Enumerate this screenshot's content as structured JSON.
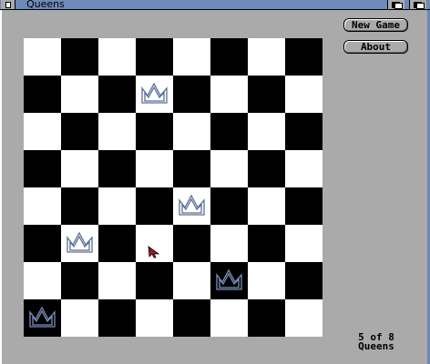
{
  "window": {
    "title": "Queens"
  },
  "buttons": {
    "new_game": "New Game",
    "about": "About"
  },
  "status": {
    "line1": "5 of 8",
    "line2": "Queens"
  },
  "colors": {
    "titlebar": "#6d8ab8",
    "background": "#aaaaaa",
    "queen_light_square": "#5a6f95",
    "queen_dark_square": "#7b8fb8",
    "pointer": "#a01830"
  },
  "board": {
    "size": 8,
    "top_left_square": "light",
    "queens": [
      {
        "row": 1,
        "col": 3
      },
      {
        "row": 4,
        "col": 4
      },
      {
        "row": 5,
        "col": 1
      },
      {
        "row": 6,
        "col": 5
      },
      {
        "row": 7,
        "col": 0
      }
    ]
  },
  "icons": {
    "queen": "crown-icon",
    "pointer": "mouse-pointer-icon",
    "close": "close-icon",
    "depth": "depth-arrange-icon"
  }
}
